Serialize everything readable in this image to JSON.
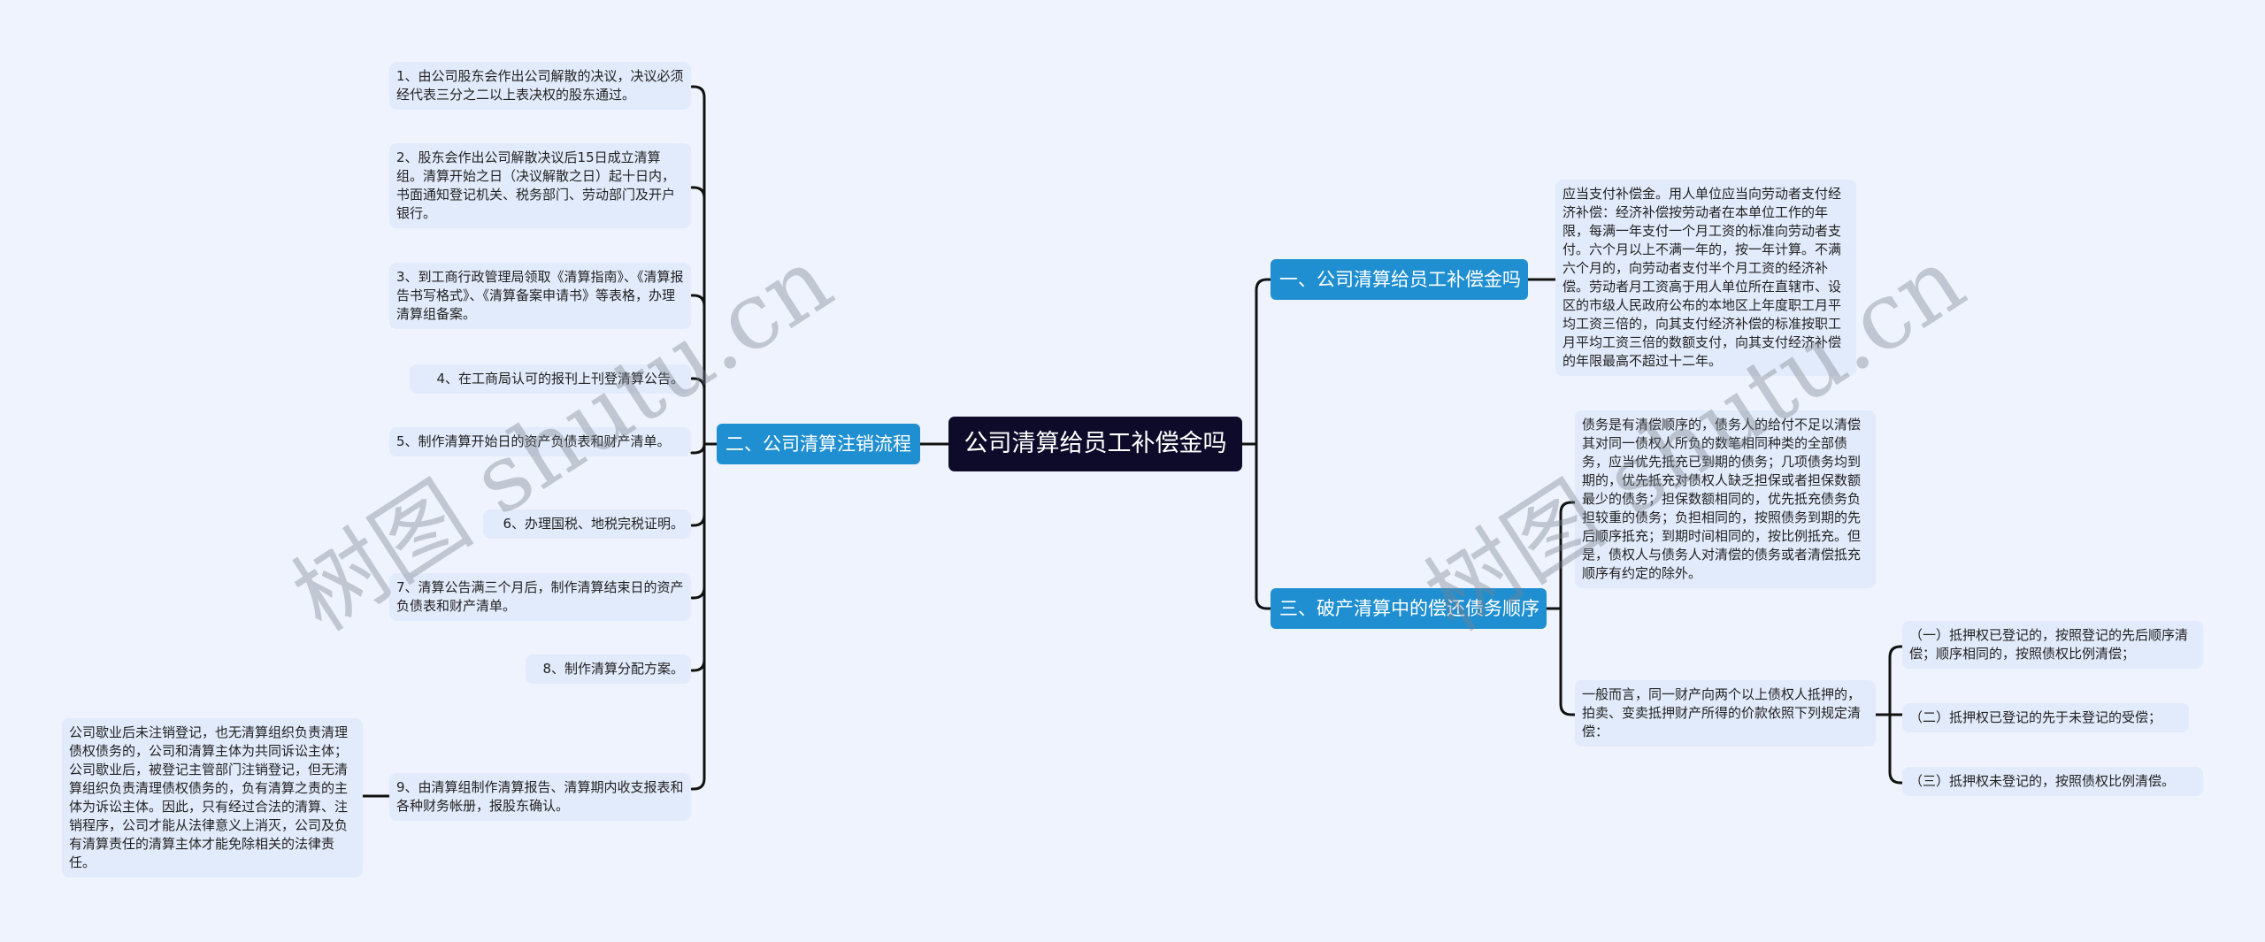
{
  "root": {
    "label": "公司清算给员工补偿金吗"
  },
  "branches": [
    {
      "label": "一、公司清算给员工补偿金吗",
      "children": [
        "应当支付补偿金。用人单位应当向劳动者支付经济补偿：经济补偿按劳动者在本单位工作的年限，每满一年支付一个月工资的标准向劳动者支付。六个月以上不满一年的，按一年计算。不满六个月的，向劳动者支付半个月工资的经济补偿。劳动者月工资高于用人单位所在直辖市、设区的市级人民政府公布的本地区上年度职工月平均工资三倍的，向其支付经济补偿的标准按职工月平均工资三倍的数额支付，向其支付经济补偿的年限最高不超过十二年。"
      ]
    },
    {
      "label": "二、公司清算注销流程",
      "children": [
        "1、由公司股东会作出公司解散的决议，决议必须经代表三分之二以上表决权的股东通过。",
        "2、股东会作出公司解散决议后15日成立清算组。清算开始之日（决议解散之日）起十日内，书面通知登记机关、税务部门、劳动部门及开户银行。",
        "3、到工商行政管理局领取《清算指南》、《清算报告书写格式》、《清算备案申请书》等表格，办理清算组备案。",
        "4、在工商局认可的报刊上刊登清算公告。",
        "5、制作清算开始日的资产负债表和财产清单。",
        "6、办理国税、地税完税证明。",
        "7、清算公告满三个月后，制作清算结束日的资产负债表和财产清单。",
        "8、制作清算分配方案。",
        "9、由清算组制作清算报告、清算期内收支报表和各种财务帐册，报股东确认。"
      ],
      "item9_child": "公司歇业后未注销登记，也无清算组织负责清理债权债务的，公司和清算主体为共同诉讼主体；公司歇业后，被登记主管部门注销登记，但无清算组织负责清理债权债务的，负有清算之责的主体为诉讼主体。因此，只有经过合法的清算、注销程序，公司才能从法律意义上消灭，公司及负有清算责任的清算主体才能免除相关的法律责任。"
    },
    {
      "label": "三、破产清算中的偿还债务顺序",
      "children": [
        "债务是有清偿顺序的，债务人的给付不足以清偿其对同一债权人所负的数笔相同种类的全部债务，应当优先抵充已到期的债务；几项债务均到期的，优先抵充对债权人缺乏担保或者担保数额最少的债务；担保数额相同的，优先抵充债务负担较重的债务；负担相同的，按照债务到期的先后顺序抵充；到期时间相同的，按比例抵充。但是，债权人与债务人对清偿的债务或者清偿抵充顺序有约定的除外。",
        "一般而言，同一财产向两个以上债权人抵押的，拍卖、变卖抵押财产所得的价款依照下列规定清偿："
      ],
      "mortgage_children": [
        "（一）抵押权已登记的，按照登记的先后顺序清偿；顺序相同的，按照债权比例清偿；",
        "（二）抵押权已登记的先于未登记的受偿；",
        "（三）抵押权未登记的，按照债权比例清偿。"
      ]
    }
  ],
  "watermarks": [
    "树图 shutu.cn",
    "树图 shutu.cn"
  ],
  "colors": {
    "background": "#eef3fd",
    "root": "#0e0b2a",
    "branch": "#1f8fd1",
    "leaf": "#e2ebfb",
    "connector": "#111111"
  }
}
